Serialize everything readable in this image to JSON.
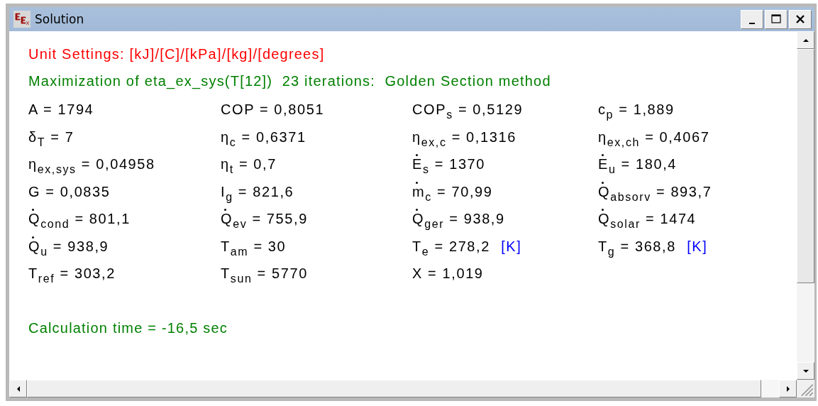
{
  "window": {
    "title": "Solution"
  },
  "header_lines": [
    {
      "kind": "units",
      "text": "Unit Settings: [kJ]/[C]/[kPa]/[kg]/[degrees]"
    },
    {
      "kind": "status",
      "text": "Maximization of eta_ex_sys(T[12])  23 iterations:  Golden Section method"
    }
  ],
  "variables": [
    {
      "text": "A = 1794",
      "dot": false
    },
    {
      "text": "COP = 0,8051",
      "dot": false
    },
    {
      "text": "COP$_{s}$ = 0,5129",
      "dot": false
    },
    {
      "text": "c$_{p}$ = 1,889",
      "dot": false
    },
    {
      "text": "δ$_{T}$ = 7",
      "dot": false
    },
    {
      "text": "η$_{c}$ = 0,6371",
      "dot": false
    },
    {
      "text": "η$_{ex,c}$ = 0,1316",
      "dot": false
    },
    {
      "text": "η$_{ex,ch}$ = 0,4067",
      "dot": false
    },
    {
      "text": "η$_{ex,sys}$ = 0,04958",
      "dot": false
    },
    {
      "text": "η$_{t}$ = 0,7",
      "dot": false
    },
    {
      "text": "E$_{s}$ = 1370",
      "dot": true
    },
    {
      "text": "E$_{u}$ = 180,4",
      "dot": true
    },
    {
      "text": "G = 0,0835",
      "dot": false
    },
    {
      "text": "I$_{g}$ = 821,6",
      "dot": false
    },
    {
      "text": "m$_{c}$ = 70,99",
      "dot": true
    },
    {
      "text": "Q$_{absorv}$ = 893,7",
      "dot": true
    },
    {
      "text": "Q$_{cond}$ = 801,1",
      "dot": true
    },
    {
      "text": "Q$_{ev}$ = 755,9",
      "dot": true
    },
    {
      "text": "Q$_{ger}$ = 938,9",
      "dot": true
    },
    {
      "text": "Q$_{solar}$ = 1474",
      "dot": true
    },
    {
      "text": "Q$_{u}$ = 938,9",
      "dot": true
    },
    {
      "text": "T$_{am}$ = 30",
      "dot": false
    },
    {
      "text": "T$_{e}$ = 278,2",
      "dot": false,
      "unit": "[K]"
    },
    {
      "text": "T$_{g}$ = 368,8",
      "dot": false,
      "unit": "[K]"
    },
    {
      "text": "T$_{ref}$ = 303,2",
      "dot": false
    },
    {
      "text": "T$_{sun}$ = 5770",
      "dot": false
    },
    {
      "text": "X = 1,019",
      "dot": false
    }
  ],
  "footer_line": {
    "kind": "status",
    "text": "Calculation time = -16,5 sec"
  }
}
